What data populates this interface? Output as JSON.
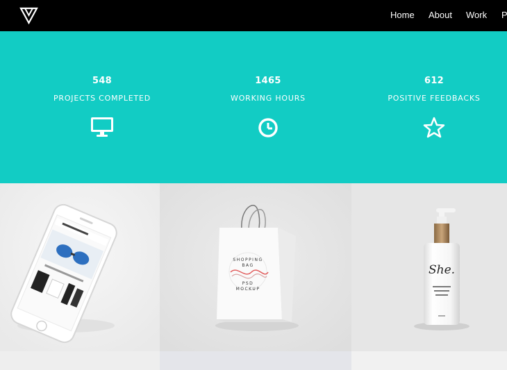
{
  "nav": {
    "logo_icon": "triangle-logo-icon",
    "links": [
      "Home",
      "About",
      "Work",
      "P"
    ]
  },
  "stats": [
    {
      "value": "548",
      "label": "PROJECTS COMPLETED",
      "icon": "monitor-icon"
    },
    {
      "value": "1465",
      "label": "WORKING HOURS",
      "icon": "clock-icon"
    },
    {
      "value": "612",
      "label": "POSITIVE FEEDBACKS",
      "icon": "star-icon"
    }
  ],
  "portfolio": {
    "items": [
      {
        "name": "phone-mockup",
        "icon": "smartphone-icon"
      },
      {
        "name": "shopping-bag-mockup",
        "icon": "shopping-bag-icon",
        "bag_text": "SHOPPING BAG PSD MOCKUP"
      },
      {
        "name": "bottle-mockup",
        "icon": "bottle-icon",
        "brand": "She."
      }
    ]
  },
  "colors": {
    "nav_bg": "#000000",
    "accent": "#12ccc4",
    "text": "#ffffff"
  }
}
